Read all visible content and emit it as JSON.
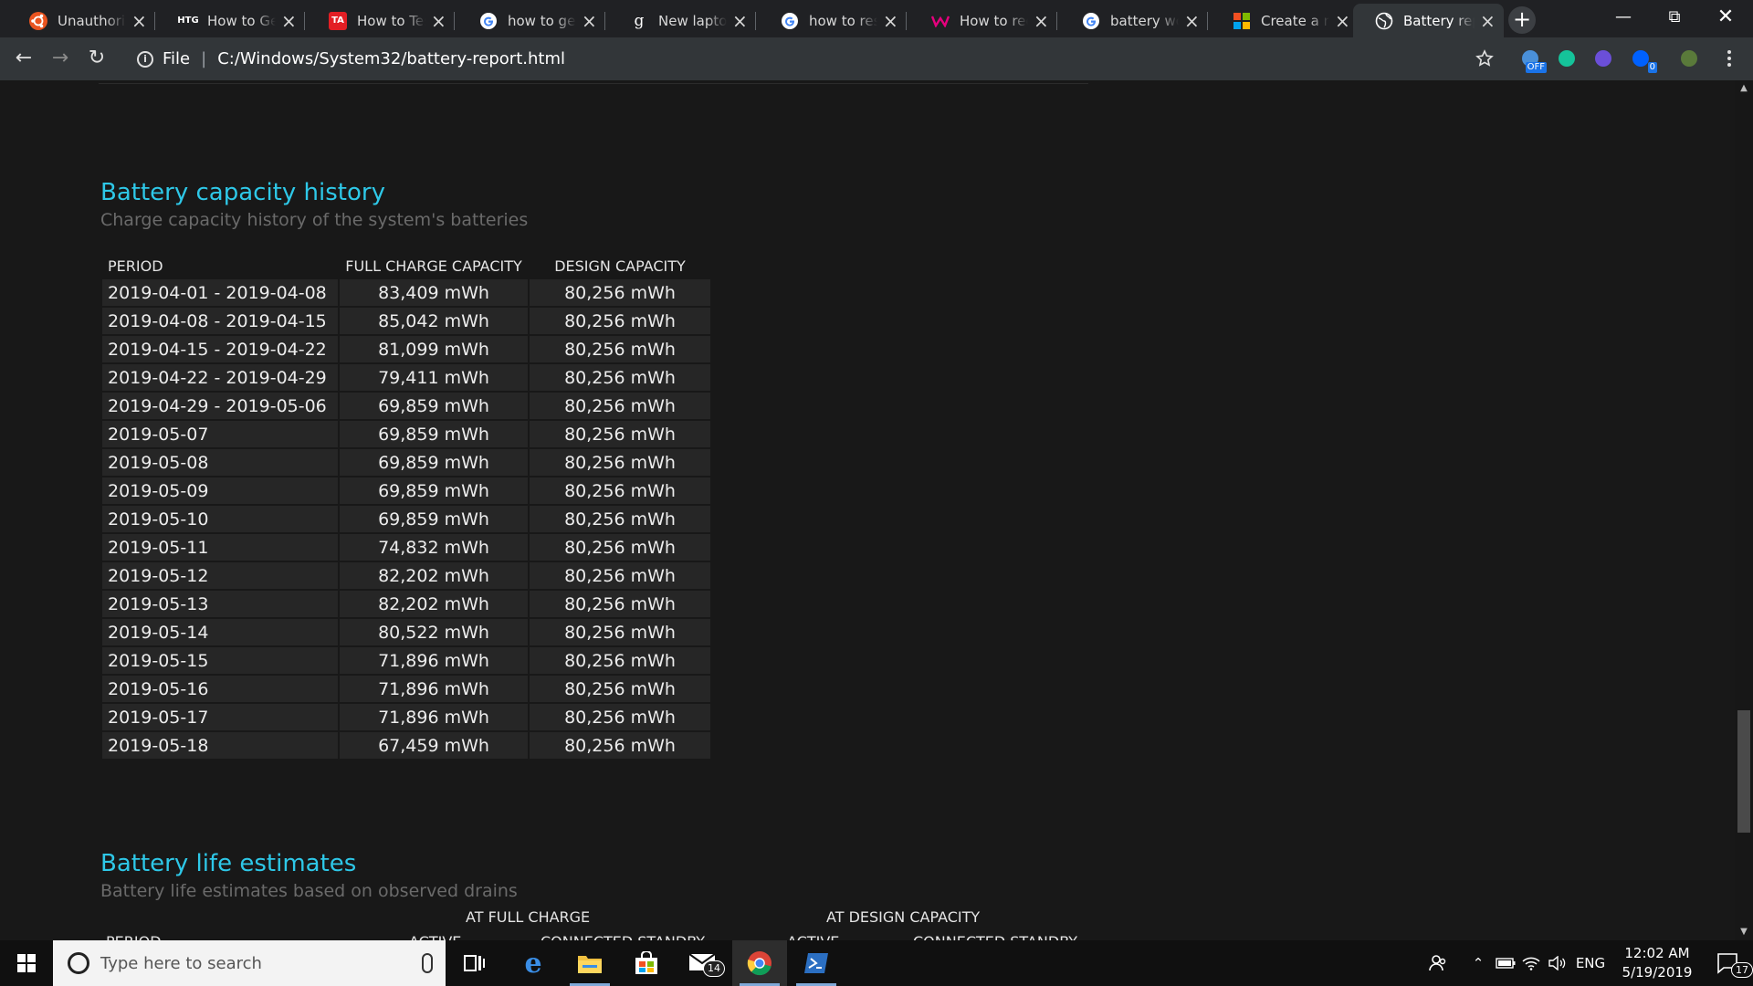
{
  "tabs": [
    {
      "title": "Unauthorized",
      "icon": "ubuntu-logo-icon",
      "color": "#e95420"
    },
    {
      "title": "How to Generate",
      "icon": "htg-logo-icon",
      "color": "#ffffff",
      "icon_text": "HTG"
    },
    {
      "title": "How to Test",
      "icon": "ta-logo-icon",
      "color": "#e31e24",
      "icon_text": "TA"
    },
    {
      "title": "how to get battery",
      "icon": "google-logo-icon",
      "color": "#ffffff"
    },
    {
      "title": "New laptop",
      "icon": "gizmodo-logo-icon",
      "color": "#ffffff",
      "icon_text": "g"
    },
    {
      "title": "how to reset",
      "icon": "google-logo-icon",
      "color": "#ffffff"
    },
    {
      "title": "How to recalibrate",
      "icon": "windows-central-logo-icon",
      "color": "#e6007e"
    },
    {
      "title": "battery wont",
      "icon": "google-logo-icon",
      "color": "#ffffff"
    },
    {
      "title": "Create a new",
      "icon": "microsoft-logo-icon",
      "color": "#f25022"
    },
    {
      "title": "Battery report",
      "icon": "globe-icon",
      "color": "#ffffff",
      "active": true
    }
  ],
  "address": {
    "scheme_label": "File",
    "url": "C:/Windows/System32/battery-report.html"
  },
  "extensions": [
    {
      "name": "weather-extension-icon",
      "badge": "OFF"
    },
    {
      "name": "grammarly-extension-icon",
      "badge": ""
    },
    {
      "name": "video-extension-icon",
      "badge": ""
    },
    {
      "name": "dropbox-extension-icon",
      "badge": "0"
    },
    {
      "name": "profile-avatar-icon",
      "badge": ""
    }
  ],
  "capacity": {
    "title": "Battery capacity history",
    "subtitle": "Charge capacity history of the system's batteries",
    "headers": [
      "PERIOD",
      "FULL CHARGE CAPACITY",
      "DESIGN CAPACITY"
    ],
    "rows": [
      [
        "2019-04-01 - 2019-04-08",
        "83,409 mWh",
        "80,256 mWh"
      ],
      [
        "2019-04-08 - 2019-04-15",
        "85,042 mWh",
        "80,256 mWh"
      ],
      [
        "2019-04-15 - 2019-04-22",
        "81,099 mWh",
        "80,256 mWh"
      ],
      [
        "2019-04-22 - 2019-04-29",
        "79,411 mWh",
        "80,256 mWh"
      ],
      [
        "2019-04-29 - 2019-05-06",
        "69,859 mWh",
        "80,256 mWh"
      ],
      [
        "2019-05-07",
        "69,859 mWh",
        "80,256 mWh"
      ],
      [
        "2019-05-08",
        "69,859 mWh",
        "80,256 mWh"
      ],
      [
        "2019-05-09",
        "69,859 mWh",
        "80,256 mWh"
      ],
      [
        "2019-05-10",
        "69,859 mWh",
        "80,256 mWh"
      ],
      [
        "2019-05-11",
        "74,832 mWh",
        "80,256 mWh"
      ],
      [
        "2019-05-12",
        "82,202 mWh",
        "80,256 mWh"
      ],
      [
        "2019-05-13",
        "82,202 mWh",
        "80,256 mWh"
      ],
      [
        "2019-05-14",
        "80,522 mWh",
        "80,256 mWh"
      ],
      [
        "2019-05-15",
        "71,896 mWh",
        "80,256 mWh"
      ],
      [
        "2019-05-16",
        "71,896 mWh",
        "80,256 mWh"
      ],
      [
        "2019-05-17",
        "71,896 mWh",
        "80,256 mWh"
      ],
      [
        "2019-05-18",
        "67,459 mWh",
        "80,256 mWh"
      ]
    ]
  },
  "estimates": {
    "title": "Battery life estimates",
    "subtitle": "Battery life estimates based on observed drains",
    "group_full": "AT FULL CHARGE",
    "group_design": "AT DESIGN CAPACITY",
    "col_period": "PERIOD",
    "col_active": "ACTIVE",
    "col_standby": "CONNECTED STANDBY"
  },
  "taskbar": {
    "search_placeholder": "Type here to search",
    "mail_badge": "14",
    "language": "ENG",
    "time": "12:02 AM",
    "date": "5/19/2019",
    "notifications": "17"
  },
  "colors": {
    "accent_heading": "#2ec8e8",
    "page_bg": "#181818",
    "cell_bg": "#262626"
  }
}
